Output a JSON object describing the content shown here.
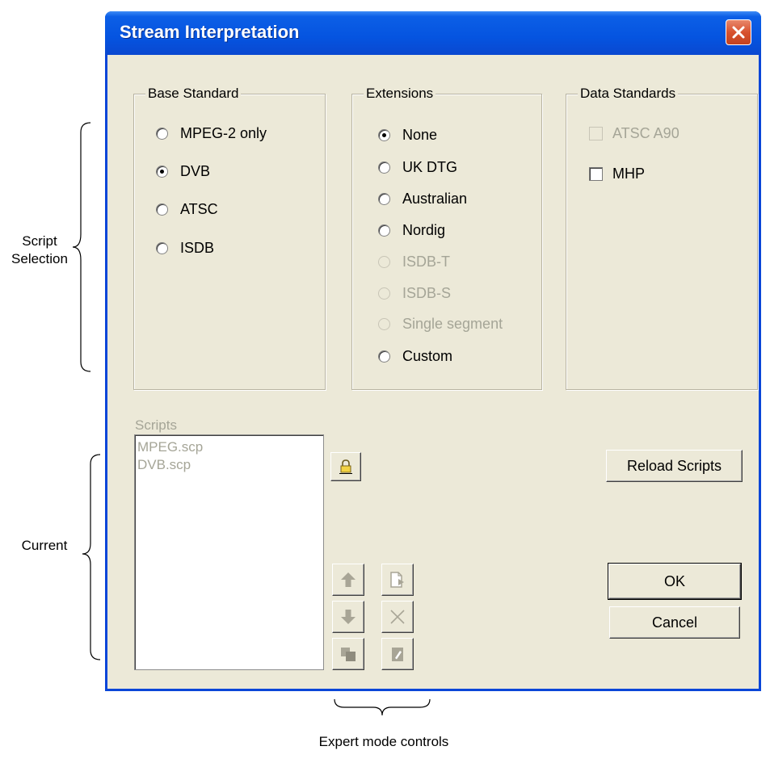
{
  "dialog": {
    "title": "Stream Interpretation"
  },
  "base_standard": {
    "legend": "Base Standard",
    "options": [
      {
        "label": "MPEG-2 only",
        "checked": false,
        "enabled": true
      },
      {
        "label": "DVB",
        "checked": true,
        "enabled": true
      },
      {
        "label": "ATSC",
        "checked": false,
        "enabled": true
      },
      {
        "label": "ISDB",
        "checked": false,
        "enabled": true
      }
    ]
  },
  "extensions": {
    "legend": "Extensions",
    "options": [
      {
        "label": "None",
        "checked": true,
        "enabled": true
      },
      {
        "label": "UK DTG",
        "checked": false,
        "enabled": true
      },
      {
        "label": "Australian",
        "checked": false,
        "enabled": true
      },
      {
        "label": "Nordig",
        "checked": false,
        "enabled": true
      },
      {
        "label": "ISDB-T",
        "checked": false,
        "enabled": false
      },
      {
        "label": "ISDB-S",
        "checked": false,
        "enabled": false
      },
      {
        "label": "Single segment",
        "checked": false,
        "enabled": false
      },
      {
        "label": "Custom",
        "checked": false,
        "enabled": true
      }
    ]
  },
  "data_standards": {
    "legend": "Data Standards",
    "options": [
      {
        "label": "ATSC A90",
        "checked": false,
        "enabled": false
      },
      {
        "label": "MHP",
        "checked": false,
        "enabled": true
      }
    ]
  },
  "scripts": {
    "label": "Scripts",
    "items": [
      "MPEG.scp",
      "DVB.scp"
    ]
  },
  "buttons": {
    "reload": "Reload Scripts",
    "ok": "OK",
    "cancel": "Cancel"
  },
  "icons": {
    "lock": "lock-icon",
    "move_up": "arrow-up-icon",
    "move_down": "arrow-down-icon",
    "add": "add-document-icon",
    "delete": "delete-x-icon",
    "copy": "copy-icon",
    "edit": "edit-document-icon"
  },
  "annotations": {
    "script_selection": "Script\nSelection",
    "current": "Current",
    "expert": "Expert mode controls"
  },
  "colors": {
    "titlebar": "#0554e0",
    "close": "#d8522f",
    "face": "#ece9d8",
    "disabled_text": "#a5a597"
  }
}
